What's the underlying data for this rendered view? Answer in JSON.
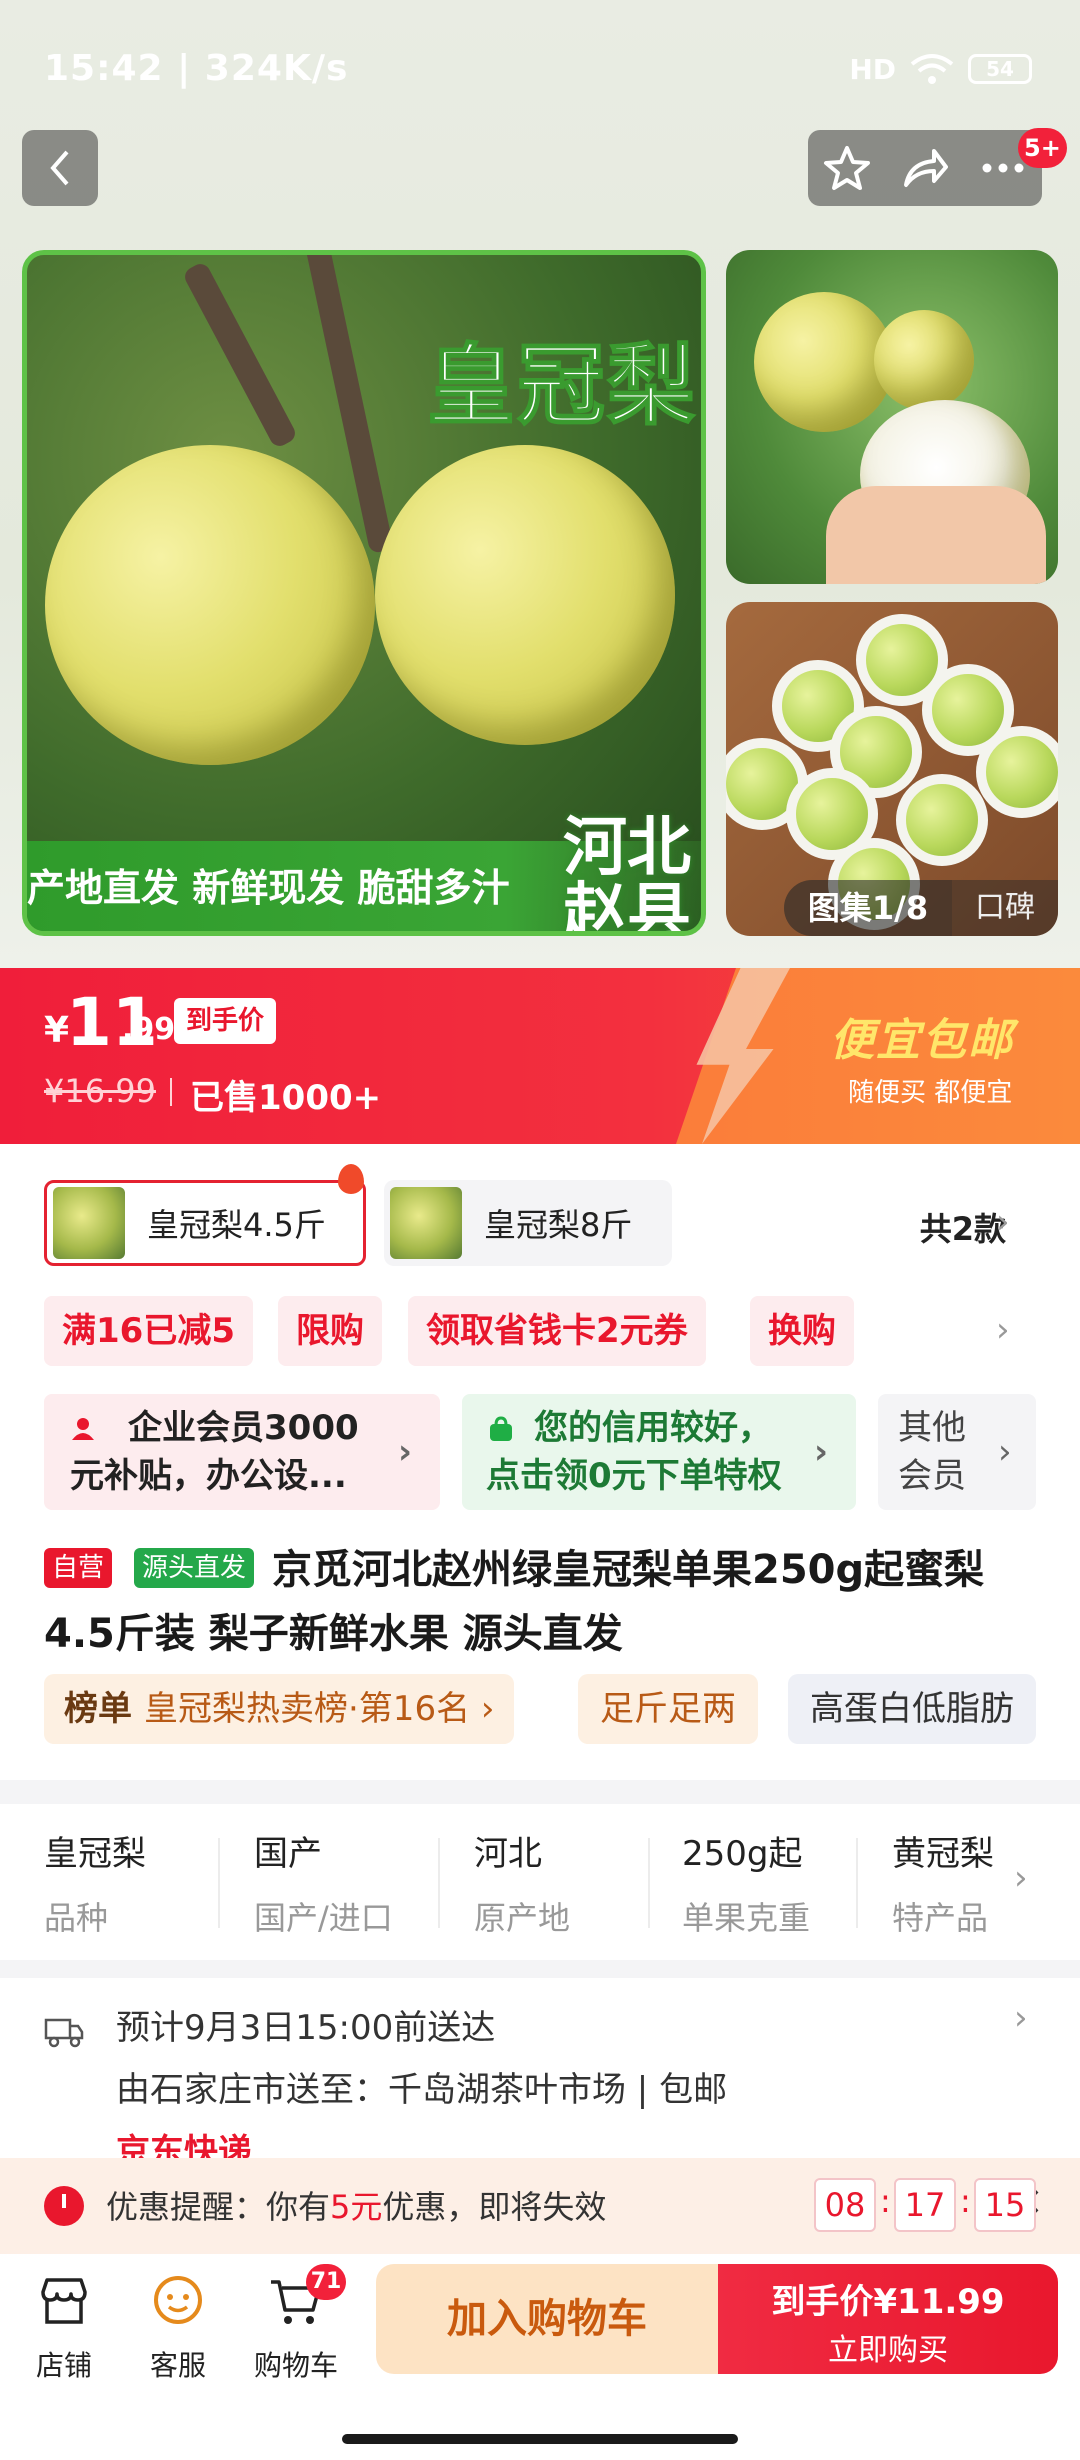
{
  "status_bar": {
    "time": "15:42 | 324K/s",
    "signal": "HD",
    "battery": "54"
  },
  "nav": {
    "cart_badge": "5+"
  },
  "gallery": {
    "main_title": "皇冠梨",
    "main_strip": "产地直发 新鲜现发 脆甜多汁",
    "main_origin_line1": "河北",
    "main_origin_line2": "赵县",
    "counter": "图集1/8",
    "review_tab": "口碑"
  },
  "price": {
    "currency": "¥",
    "integer": "11",
    "decimal": ".99",
    "tag": "到手价",
    "original": "¥16.99",
    "sold": "已售1000+",
    "promo_title": "便宜包邮",
    "promo_subtitle": "随便买 都便宜"
  },
  "variants": {
    "items": [
      {
        "label": "皇冠梨4.5斤"
      },
      {
        "label": "皇冠梨8斤"
      }
    ],
    "count": "共2款"
  },
  "coupons": [
    "满16已减5",
    "限购",
    "领取省钱卡2元券",
    "换购"
  ],
  "members": {
    "m1_line1": "企业会员3000",
    "m1_line2": "元补贴，办公设...",
    "m2_line1": "您的信用较好，",
    "m2_line2": "点击领0元下单特权",
    "m3_line1": "其他",
    "m3_line2": "会员"
  },
  "product": {
    "tag_self": "自营",
    "tag_source": "源头直发",
    "title": "京觅河北赵州绿皇冠梨单果250g起蜜梨4.5斤装 梨子新鲜水果 源头直发"
  },
  "rank": {
    "label": "榜单",
    "text": "皇冠梨热卖榜·第16名 ›"
  },
  "chips": [
    "足斤足两",
    "高蛋白低脂肪"
  ],
  "specs": [
    {
      "value": "皇冠梨",
      "key": "品种"
    },
    {
      "value": "国产",
      "key": "国产/进口"
    },
    {
      "value": "河北",
      "key": "原产地"
    },
    {
      "value": "250g起",
      "key": "单果克重"
    },
    {
      "value": "黄冠梨",
      "key": "特产品"
    }
  ],
  "delivery": {
    "eta": "预计9月3日15:00前送达",
    "route": "由石家庄市送至：千岛湖茶叶市场 | 包邮",
    "service": "京东快递"
  },
  "reminder": {
    "prefix": "优惠提醒：你有",
    "amount": "5元",
    "suffix": "优惠，即将失效",
    "countdown": [
      "08",
      "17",
      "15"
    ]
  },
  "bottom_bar": {
    "store": "店铺",
    "service": "客服",
    "cart": "购物车",
    "cart_count": "71",
    "add_to_cart": "加入购物车",
    "buy_price_label": "到手价",
    "buy_price": "¥11.99",
    "buy_now": "立即购买"
  },
  "colors": {
    "accent_red": "#e9172d",
    "promo_orange": "#fb7d3a",
    "green_badge": "#24a84a"
  }
}
